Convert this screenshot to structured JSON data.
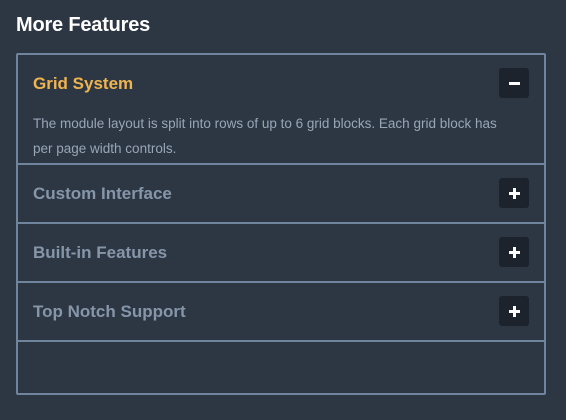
{
  "section": {
    "title": "More Features"
  },
  "accordion": {
    "items": [
      {
        "title": "Grid System",
        "expanded": true,
        "toggle_icon": "minus-icon",
        "body": "The module layout is split into rows of up to 6 grid blocks. Each grid block has per page width controls."
      },
      {
        "title": "Custom Interface",
        "expanded": false,
        "toggle_icon": "plus-icon"
      },
      {
        "title": "Built-in Features",
        "expanded": false,
        "toggle_icon": "plus-icon"
      },
      {
        "title": "Top Notch Support",
        "expanded": false,
        "toggle_icon": "plus-icon"
      }
    ]
  },
  "colors": {
    "background": "#2d3744",
    "border": "#6f849d",
    "active_title": "#f0b44e",
    "inactive_title": "#8696a9",
    "body_text": "#98a6b6",
    "button_bg": "#1d232c"
  }
}
